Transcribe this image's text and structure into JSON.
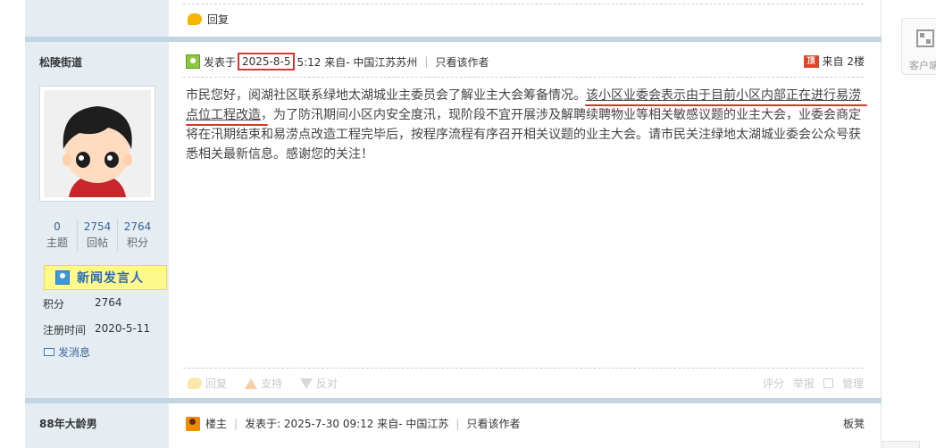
{
  "prev_post": {
    "reply_label": "回复"
  },
  "post": {
    "author": "松陵街道",
    "stats": [
      {
        "num": "0",
        "label": "主题"
      },
      {
        "num": "2754",
        "label": "回帖"
      },
      {
        "num": "2764",
        "label": "积分"
      }
    ],
    "medal": "新闻发言人",
    "points_label": "积分",
    "points_value": "2764",
    "reg_label": "注册时间",
    "reg_value": "2020-5-11",
    "message_label": "发消息",
    "posted_prefix": "发表于",
    "posted_date": "2025-8-5",
    "posted_rest": "5:12 来自- 中国江苏苏州",
    "only_author": "只看该作者",
    "floor_prefix": "顶",
    "floor_label": "来自 2楼",
    "body_part1": "市民您好，阅湖社区联系绿地太湖城业主委员会了解业主大会筹备情况。",
    "body_highlight": "该小区业委会表示由于目前小区内部正在进行易涝点位工程改造",
    "body_part2": "，为了防汛期间小区内安全度汛，现阶段不宜开展涉及解聘续聘物业等相关敏感议题的业主大会，业委会商定将在汛期结束和易涝点改造工程完毕后，按程序流程有序召开相关议题的业主大会。请市民关注绿地太湖城业委会公众号获悉相关最新信息。感谢您的关注！",
    "actions": {
      "reply": "回复",
      "support": "支持",
      "oppose": "反对",
      "rate": "评分",
      "report": "举报",
      "manage": "管理"
    },
    "accent_red": "#e6332a"
  },
  "next_post": {
    "author": "88年大龄男",
    "louzhu": "楼主",
    "posted": "发表于: 2025-7-30 09:12 来自- 中国江苏",
    "only_author": "只看该作者",
    "floor_label": "板凳"
  },
  "sidebar_widget": {
    "label": "客户端"
  }
}
